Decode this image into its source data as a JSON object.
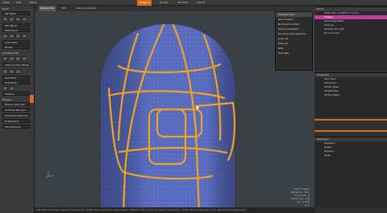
{
  "menubar": {
    "items": [
      "Mesh",
      "Edit",
      "Select",
      "Polygon",
      "Render",
      "Animate",
      "Layout"
    ],
    "active": "Polygon"
  },
  "viewport": {
    "tabs": [
      "Perspective",
      "Grid",
      "Instance Position"
    ],
    "info": [
      "Auto Shapes",
      "Polygons : Face",
      "Channels : 0",
      "Deformers : ON",
      "GL : 1,024",
      "0 m"
    ],
    "mesh_color": "#5c6fc2",
    "edge_color": "#f0a220"
  },
  "left_panel": {
    "sections": [
      {
        "title": "Tools",
        "buttons": [
          "Tab Mesh",
          "Poly Bevel",
          "Edge Slice",
          "Loop Slice",
          "Bridge"
        ]
      },
      {
        "title": "Sel Mesh Edit",
        "buttons": [
          "Sel Mesh",
          "Apply Surface Bevel",
          "Add Point",
          "Subdivide",
          "Thicken",
          "Reduce"
        ]
      },
      {
        "title": "Polygon",
        "buttons": [
          "Polygon Extrude",
          "Contract Polygon",
          "Subdivide Polygons",
          "Tri Polygons",
          "Flip Polygons"
        ]
      }
    ]
  },
  "hud_panel": {
    "title": "Selected Sets",
    "items": [
      "Quick Select",
      "By Previous Mesh",
      "Select",
      "Drop to Selection",
      "Selection Sets",
      "Remove from selection",
      "Shrink selection",
      "Loop sel",
      "Bevel",
      "Step sel",
      "Rename Selection",
      "Sets",
      "Rounded",
      "Sub Sets"
    ]
  },
  "right_panel": {
    "items_tabs": [
      "Items",
      "Shading",
      "Groups",
      "Images"
    ],
    "items_rows": [
      "Mesh Item (0.3907,0.74,0.0)",
      "Shapes",
      "Pivot Edge Mesh",
      "Camera",
      "Directional Light",
      "Environment"
    ],
    "highlight_row": 1,
    "props_tabs": [
      "Properties",
      "Display",
      "Lists"
    ],
    "props_rows": [
      "Item Sets",
      "Deformers",
      "Vertex Maps",
      "Weight Map",
      "Texture Maps"
    ],
    "channels_tabs": [
      "Channels",
      "Groups"
    ],
    "channel_rows": [
      "Selection",
      "Shape",
      "Rotation",
      "Scale"
    ]
  },
  "status_bar": {
    "text": "Left Click and Drag: Select Components | Right Click and Drag: Lasso Select | Middle Click and Drag: Select Connected | Shift: Add to Selection | Ctrl: Remove from Selection"
  }
}
